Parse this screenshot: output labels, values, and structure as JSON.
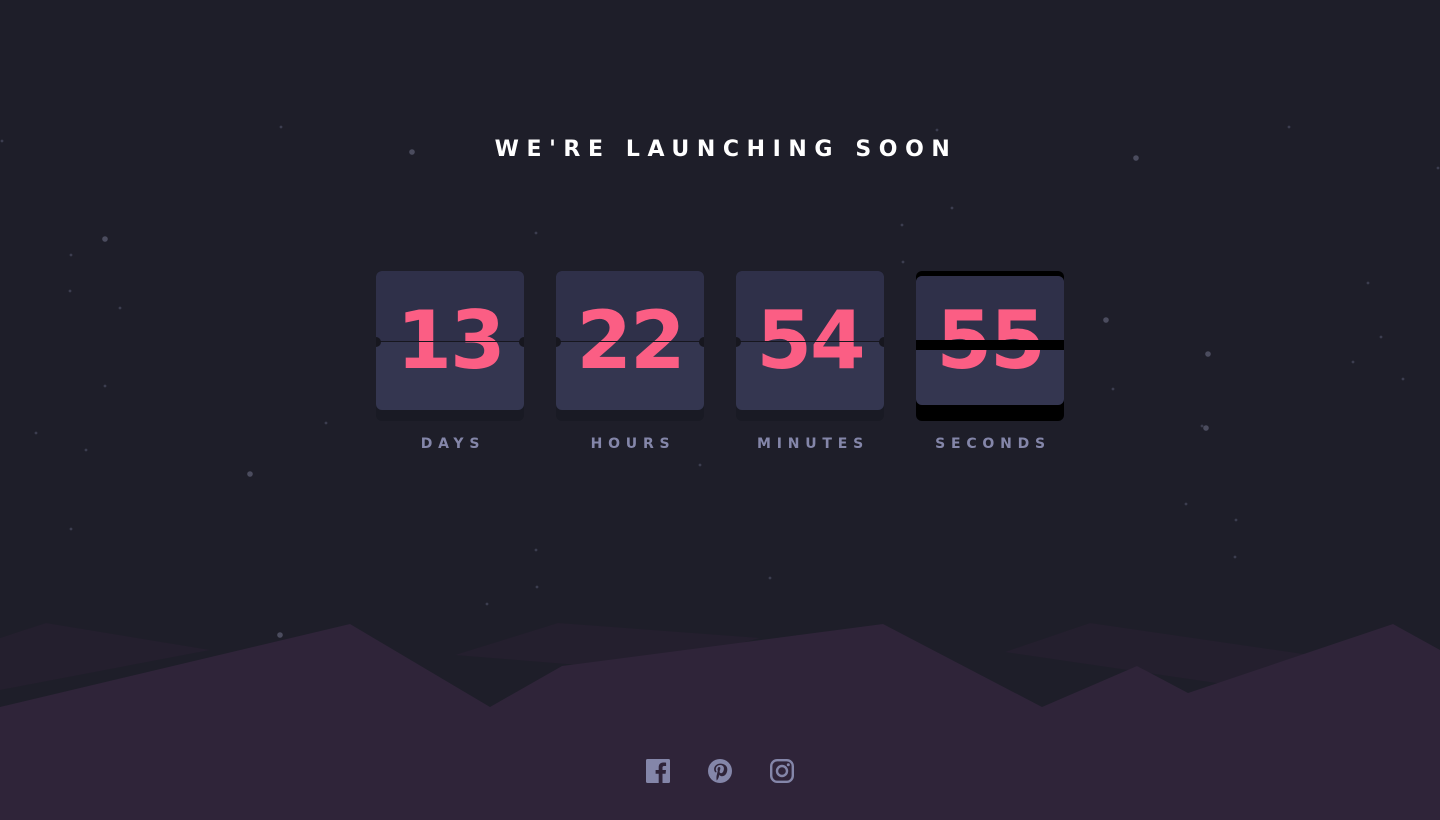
{
  "page": {
    "heading": "WE'RE LAUNCHING SOON"
  },
  "countdown": [
    {
      "value": "13",
      "label": "DAYS"
    },
    {
      "value": "22",
      "label": "HOURS"
    },
    {
      "value": "54",
      "label": "MINUTES"
    },
    {
      "value": "55",
      "label": "SECONDS",
      "flipping": true
    }
  ],
  "social_links": [
    {
      "icon": "facebook-icon"
    },
    {
      "icon": "pinterest-icon"
    },
    {
      "icon": "instagram-icon"
    }
  ],
  "colors": {
    "background": "#1e1e29",
    "card_face": "#343650",
    "card_shadow": "#191a24",
    "digit": "#fb5e84",
    "label": "#8486a9",
    "hills_front": "#2f2439",
    "hills_back": "#241f2e",
    "social_icon": "#8486a9"
  }
}
